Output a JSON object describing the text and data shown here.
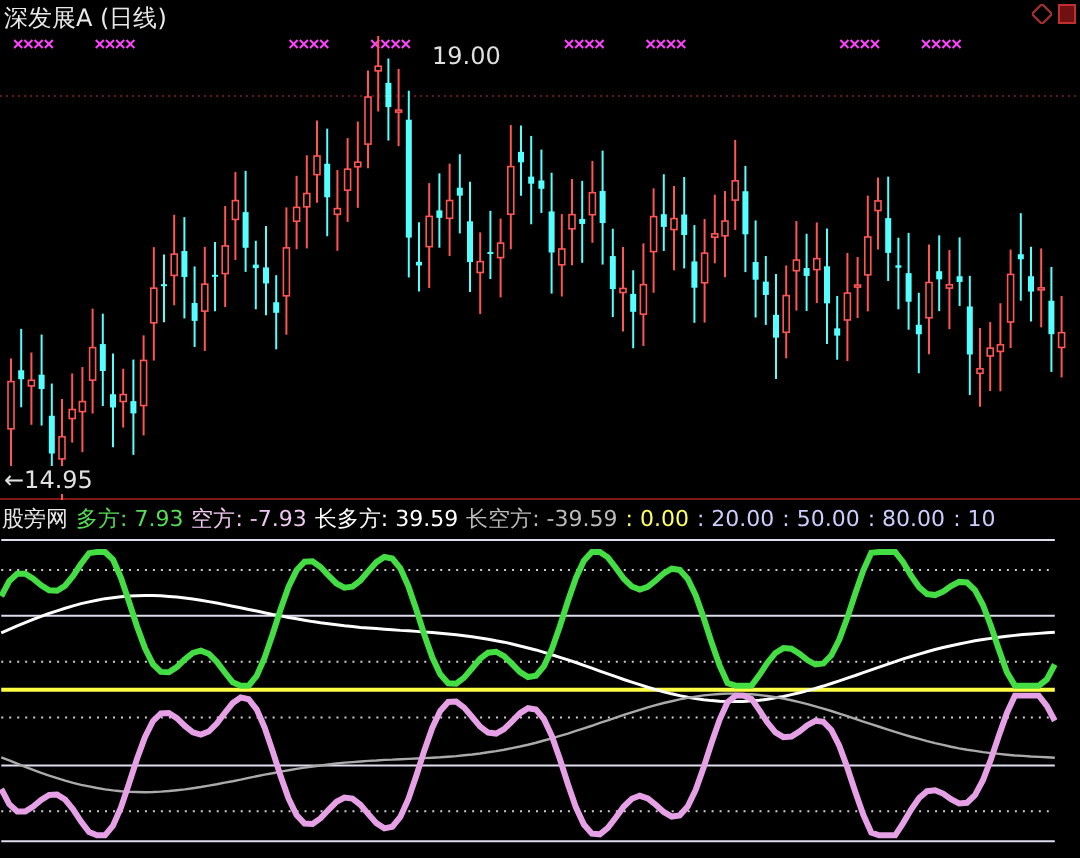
{
  "chart": {
    "title": "深发展A (日线)",
    "high_label": "19.00",
    "low_label": "←14.95"
  },
  "indicator": {
    "name": "股旁网",
    "readings": [
      {
        "label": "多方:",
        "value": "7.93",
        "color": "#55dd55"
      },
      {
        "label": "空方:",
        "value": "-7.93",
        "color": "#eec8ee"
      },
      {
        "label": "长多方:",
        "value": "39.59",
        "color": "#ffffff"
      },
      {
        "label": "长空方:",
        "value": "-39.59",
        "color": "#bbbbbb"
      },
      {
        "label": ":",
        "value": "0.00",
        "color": "#ffff66"
      },
      {
        "label": ":",
        "value": "20.00",
        "color": "#ccccff"
      },
      {
        "label": ":",
        "value": "50.00",
        "color": "#ccccff"
      },
      {
        "label": ":",
        "value": "80.00",
        "color": "#ccccff"
      },
      {
        "label": ":",
        "value": "10",
        "color": "#ccccff"
      }
    ]
  }
}
